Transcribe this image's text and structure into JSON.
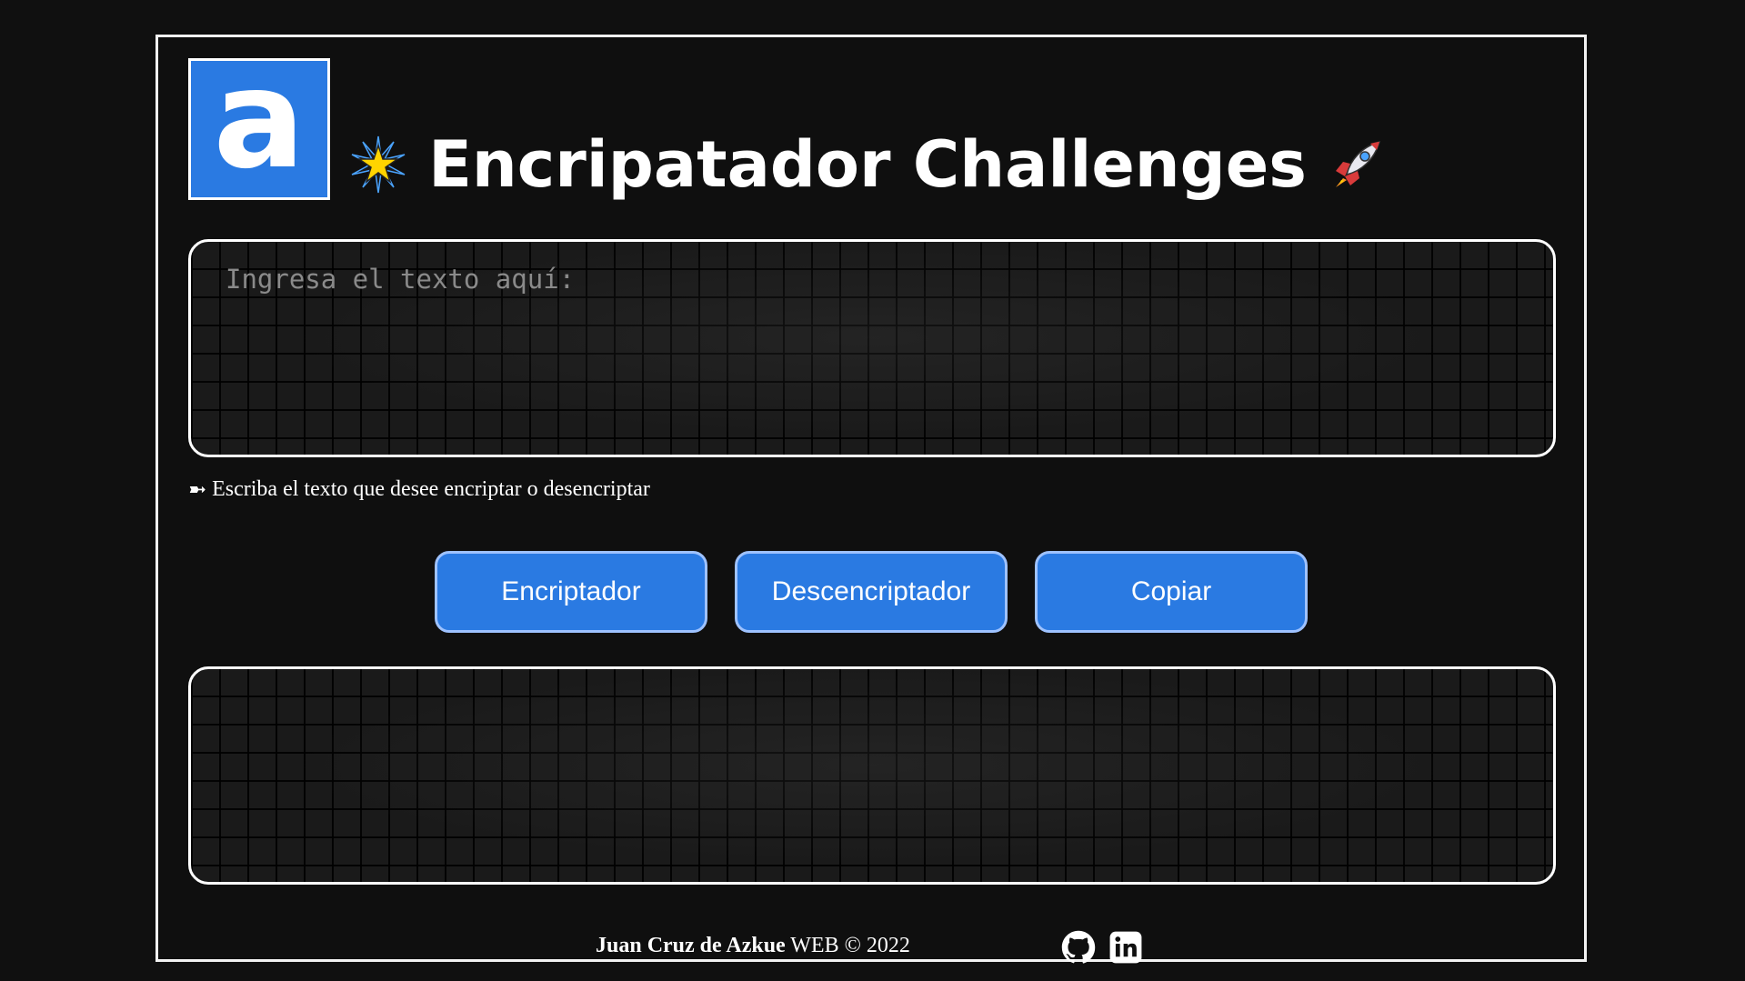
{
  "header": {
    "logo_letter": "a",
    "title": "Encripatador Challenges",
    "title_left_icon": "sparkle-star-icon",
    "title_right_icon": "rocket-icon"
  },
  "input": {
    "placeholder": "Ingresa el texto aquí:",
    "value": ""
  },
  "hint": {
    "arrow": "➼",
    "text": "Escriba el texto que desee encriptar o desencriptar"
  },
  "buttons": {
    "encrypt": "Encriptador",
    "decrypt": "Descencriptador",
    "copy": "Copiar"
  },
  "output": {
    "value": ""
  },
  "footer": {
    "author": "Juan Cruz de Azkue",
    "suffix": "WEB © 2022",
    "icons": [
      "github-icon",
      "linkedin-icon"
    ]
  },
  "colors": {
    "background": "#101010",
    "accent": "#2a7ae2",
    "button_border": "#9ec2ff",
    "frame": "#f2f2f2"
  }
}
